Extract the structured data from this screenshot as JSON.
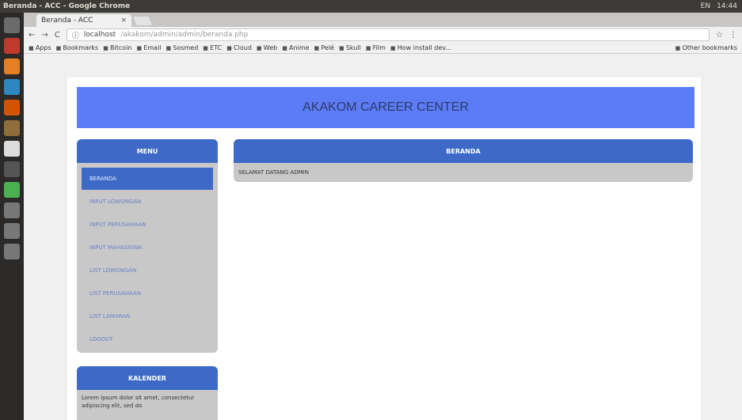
{
  "os": {
    "window_title": "Beranda - ACC - Google Chrome",
    "tray": [
      "EN",
      "14:44"
    ]
  },
  "browser": {
    "tab_title": "Beranda - ACC",
    "url_host": "localhost",
    "url_rest": "/akakom/admin/admin/beranda.php",
    "bookmarks": [
      "Apps",
      "Bookmarks",
      "Bitcoin",
      "Email",
      "Sosmed",
      "ETC",
      "Cloud",
      "Web",
      "Anime",
      "Pelé",
      "Skull",
      "Film",
      "How install dev...",
      "Other bookmarks"
    ]
  },
  "page": {
    "banner_title": "AKAKOM CAREER CENTER",
    "menu_title": "MENU",
    "menu_items": [
      "BERANDA",
      "INPUT LOWONGAN",
      "INPUT PERUSAHAAN",
      "INPUT MAHASISWA",
      "LIST LOWONGAN",
      "LIST PERUSAHAAN",
      "LIST LAMARAN",
      "LOGOUT"
    ],
    "content_title": "BERANDA",
    "content_text": "SELAMAT DATANG ADMIN",
    "calendar_title": "KALENDER",
    "calendar_text": "Lorem ipsum dolor sit amet, consectetur adipiscing elit, sed do"
  },
  "colors": {
    "banner": "#5b7cf5",
    "header": "#3d6ac7",
    "panel": "#c8c8c8"
  }
}
